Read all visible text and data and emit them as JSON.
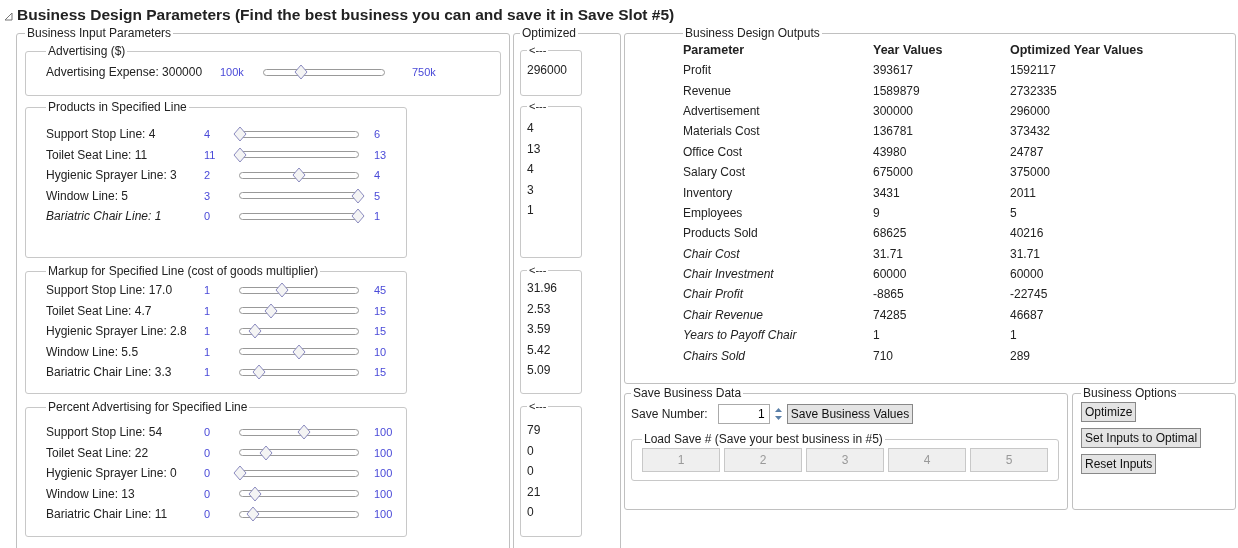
{
  "title": "Business Design Parameters (Find the best business you can and save it in Save Slot #5)",
  "inputs": {
    "title": "Business Input Parameters",
    "groups": [
      {
        "title": "Advertising ($)",
        "rows": [
          {
            "label": "Advertising Expense: 300000",
            "italic": false,
            "min": "100k",
            "max": "750k",
            "level": 0.31
          }
        ]
      },
      {
        "title": "Products in Specified Line",
        "rows": [
          {
            "label": "Support Stop Line: 4",
            "italic": false,
            "min": "4",
            "max": "6",
            "level": 0
          },
          {
            "label": "Toilet Seat Line: 11",
            "italic": false,
            "min": "11",
            "max": "13",
            "level": 0
          },
          {
            "label": "Hygienic Sprayer Line: 3",
            "italic": false,
            "min": "2",
            "max": "4",
            "level": 0.5
          },
          {
            "label": "Window Line: 5",
            "italic": false,
            "min": "3",
            "max": "5",
            "level": 1
          },
          {
            "label": "Bariatric Chair Line: 1",
            "italic": true,
            "min": "0",
            "max": "1",
            "level": 1
          }
        ]
      },
      {
        "title": "Markup for Specified Line (cost of goods multiplier)",
        "rows": [
          {
            "label": "Support Stop Line: 17.0",
            "italic": false,
            "min": "1",
            "max": "45",
            "level": 0.36
          },
          {
            "label": "Toilet Seat Line: 4.7",
            "italic": false,
            "min": "1",
            "max": "15",
            "level": 0.26
          },
          {
            "label": "Hygienic Sprayer Line: 2.8",
            "italic": false,
            "min": "1",
            "max": "15",
            "level": 0.13
          },
          {
            "label": "Window Line: 5.5",
            "italic": false,
            "min": "1",
            "max": "10",
            "level": 0.5
          },
          {
            "label": "Bariatric Chair Line: 3.3",
            "italic": false,
            "min": "1",
            "max": "15",
            "level": 0.16
          }
        ]
      },
      {
        "title": "Percent Advertising for Specified Line",
        "rows": [
          {
            "label": "Support Stop Line: 54",
            "italic": false,
            "min": "0",
            "max": "100",
            "level": 0.54
          },
          {
            "label": "Toilet Seat Line: 22",
            "italic": false,
            "min": "0",
            "max": "100",
            "level": 0.22
          },
          {
            "label": "Hygienic Sprayer Line: 0",
            "italic": false,
            "min": "0",
            "max": "100",
            "level": 0
          },
          {
            "label": "Window Line: 13",
            "italic": false,
            "min": "0",
            "max": "100",
            "level": 0.13
          },
          {
            "label": "Bariatric Chair Line: 11",
            "italic": false,
            "min": "0",
            "max": "100",
            "level": 0.11
          }
        ]
      }
    ]
  },
  "optimized": {
    "title": "Optimized",
    "groups": [
      {
        "title": "<---",
        "values": [
          "296000"
        ]
      },
      {
        "title": "<---",
        "values": [
          "4",
          "13",
          "4",
          "3",
          "1"
        ]
      },
      {
        "title": "<---",
        "values": [
          "31.96",
          "2.53",
          "3.59",
          "5.42",
          "5.09"
        ]
      },
      {
        "title": "<---",
        "values": [
          "79",
          "0",
          "0",
          "21",
          "0"
        ]
      }
    ]
  },
  "outputs": {
    "title": "Business Design Outputs",
    "columns": [
      "Parameter",
      "Year Values",
      "Optimized Year Values"
    ],
    "rows": [
      {
        "cells": [
          "Profit",
          "393617",
          "1592117"
        ],
        "italic": false
      },
      {
        "cells": [
          "Revenue",
          "1589879",
          "2732335"
        ],
        "italic": false
      },
      {
        "cells": [
          "Advertisement",
          "300000",
          "296000"
        ],
        "italic": false
      },
      {
        "cells": [
          "Materials Cost",
          "136781",
          "373432"
        ],
        "italic": false
      },
      {
        "cells": [
          "Office Cost",
          "43980",
          "24787"
        ],
        "italic": false
      },
      {
        "cells": [
          "Salary Cost",
          "675000",
          "375000"
        ],
        "italic": false
      },
      {
        "cells": [
          "Inventory",
          "3431",
          "2011"
        ],
        "italic": false
      },
      {
        "cells": [
          "Employees",
          "9",
          "5"
        ],
        "italic": false
      },
      {
        "cells": [
          "Products Sold",
          "68625",
          "40216"
        ],
        "italic": false
      },
      {
        "cells": [
          "Chair Cost",
          "31.71",
          "31.71"
        ],
        "italic": true
      },
      {
        "cells": [
          "Chair Investment",
          "60000",
          "60000"
        ],
        "italic": true
      },
      {
        "cells": [
          "Chair Profit",
          "-8865",
          "-22745"
        ],
        "italic": true
      },
      {
        "cells": [
          "Chair Revenue",
          "74285",
          "46687"
        ],
        "italic": true
      },
      {
        "cells": [
          "Years to Payoff Chair",
          "1",
          "1"
        ],
        "italic": true
      },
      {
        "cells": [
          "Chairs Sold",
          "710",
          "289"
        ],
        "italic": true
      }
    ]
  },
  "save": {
    "title": "Save Business Data",
    "label": "Save Number:",
    "value": "1",
    "button": "Save Business Values",
    "load": {
      "title": "Load Save # (Save your best business in #5)",
      "buttons": [
        {
          "label": "1",
          "disabled": true
        },
        {
          "label": "2",
          "disabled": true
        },
        {
          "label": "3",
          "disabled": true
        },
        {
          "label": "4",
          "disabled": true
        },
        {
          "label": "5",
          "disabled": true
        }
      ]
    }
  },
  "options": {
    "title": "Business Options",
    "buttons": [
      "Optimize",
      "Set Inputs to Optimal",
      "Reset Inputs"
    ]
  }
}
